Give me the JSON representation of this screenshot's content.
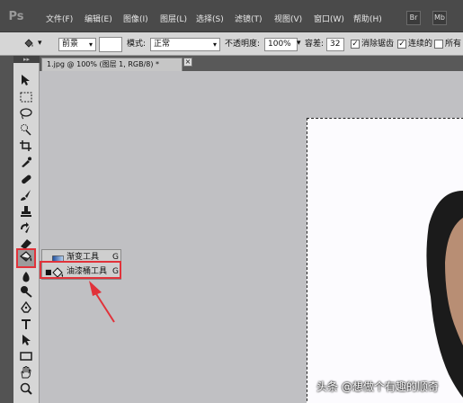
{
  "app": {
    "logo": "Ps"
  },
  "menu": {
    "items": [
      {
        "label": "文件(F)"
      },
      {
        "label": "编辑(E)"
      },
      {
        "label": "图像(I)"
      },
      {
        "label": "图层(L)"
      },
      {
        "label": "选择(S)"
      },
      {
        "label": "滤镜(T)"
      },
      {
        "label": "视图(V)"
      },
      {
        "label": "窗口(W)"
      },
      {
        "label": "帮助(H)"
      }
    ],
    "bridge_icon": "Br",
    "minibridge_icon": "Mb"
  },
  "options": {
    "fill_source": "前景",
    "mode_label": "模式:",
    "mode_value": "正常",
    "opacity_label": "不透明度:",
    "opacity_value": "100%",
    "tolerance_label": "容差:",
    "tolerance_value": "32",
    "antialias_label": "消除锯齿",
    "contiguous_label": "连续的",
    "all_layers_label": "所有"
  },
  "document": {
    "tab_title": "1.jpg @ 100% (图层 1, RGB/8) *",
    "close_glyph": "×"
  },
  "flyout": {
    "items": [
      {
        "label": "渐变工具",
        "shortcut": "G",
        "icon": "gradient-icon"
      },
      {
        "label": "油漆桶工具",
        "shortcut": "G",
        "icon": "paint-bucket-icon",
        "selected": true
      }
    ]
  },
  "tools": [
    "move-tool-icon",
    "marquee-tool-icon",
    "lasso-tool-icon",
    "quick-select-tool-icon",
    "crop-tool-icon",
    "eyedropper-tool-icon",
    "healing-brush-tool-icon",
    "brush-tool-icon",
    "clone-stamp-tool-icon",
    "history-brush-tool-icon",
    "eraser-tool-icon",
    "paint-bucket-tool-icon",
    "blur-tool-icon",
    "dodge-tool-icon",
    "pen-tool-icon",
    "type-tool-icon",
    "path-select-tool-icon",
    "rectangle-tool-icon",
    "hand-tool-icon",
    "zoom-tool-icon"
  ],
  "colors": {
    "annotation_red": "#e1323a",
    "workspace_gray": "#c0c0c3",
    "menubar_dark": "#4a4a4a"
  },
  "watermark": {
    "text": "头条 @想做个有趣的顺奇"
  }
}
